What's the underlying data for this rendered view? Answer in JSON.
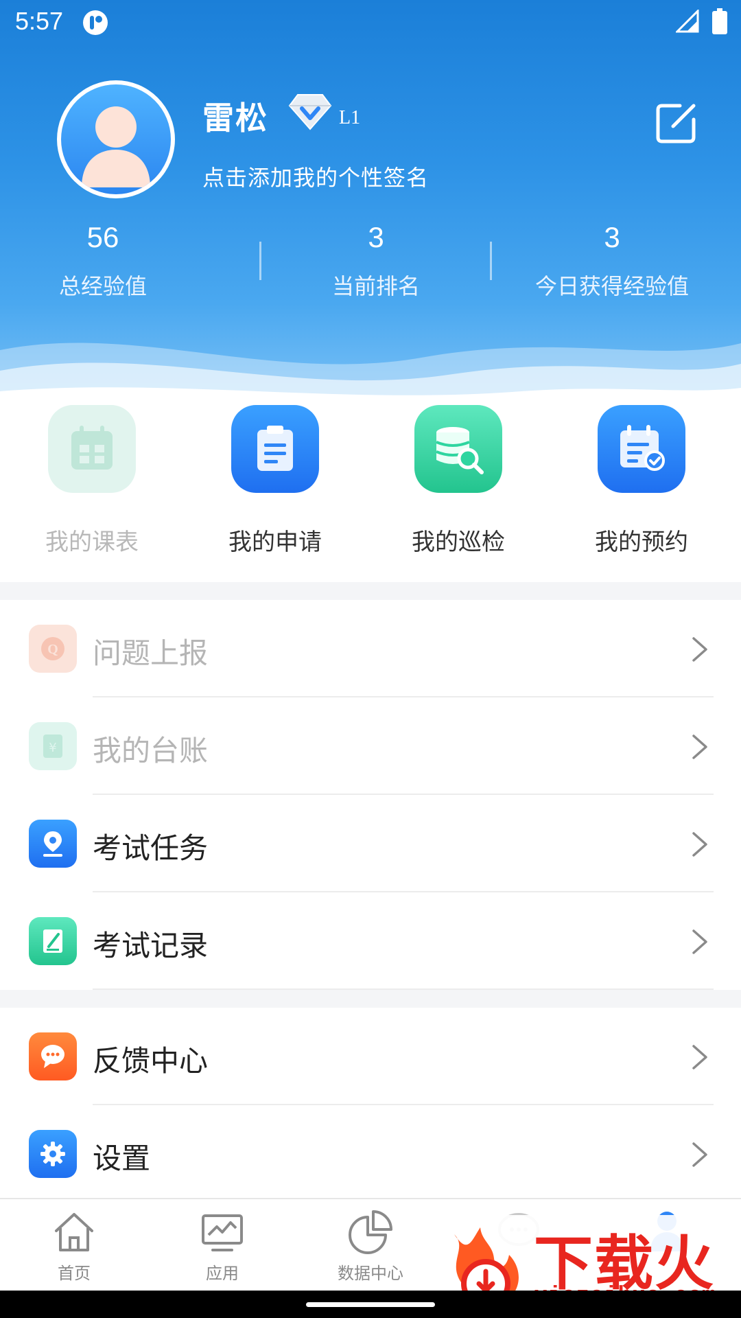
{
  "status_bar": {
    "time": "5:57"
  },
  "profile": {
    "name": "雷松",
    "level": "L1",
    "signature": "点击添加我的个性签名"
  },
  "stats": [
    {
      "value": "56",
      "label": "总经验值"
    },
    {
      "value": "3",
      "label": "当前排名"
    },
    {
      "value": "3",
      "label": "今日获得经验值"
    }
  ],
  "quick_actions": [
    {
      "label": "我的课表",
      "icon": "calendar-icon",
      "enabled": false
    },
    {
      "label": "我的申请",
      "icon": "clipboard-icon",
      "enabled": true
    },
    {
      "label": "我的巡检",
      "icon": "database-search-icon",
      "enabled": true
    },
    {
      "label": "我的预约",
      "icon": "calendar-check-icon",
      "enabled": true
    }
  ],
  "menu": [
    {
      "label": "问题上报",
      "icon": "question-report-icon",
      "enabled": false
    },
    {
      "label": "我的台账",
      "icon": "ledger-icon",
      "enabled": false
    },
    {
      "label": "考试任务",
      "icon": "pin-icon",
      "enabled": true
    },
    {
      "label": "考试记录",
      "icon": "note-pen-icon",
      "enabled": true
    },
    {
      "label": "反馈中心",
      "icon": "chat-icon",
      "enabled": true
    },
    {
      "label": "设置",
      "icon": "gear-icon",
      "enabled": true
    }
  ],
  "tabs": [
    {
      "label": "首页",
      "icon": "home-icon"
    },
    {
      "label": "应用",
      "icon": "monitor-chart-icon"
    },
    {
      "label": "数据中心",
      "icon": "pie-chart-icon"
    },
    {
      "label": "",
      "icon": "message-icon"
    },
    {
      "label": "",
      "icon": "profile-icon"
    }
  ],
  "watermark": {
    "title": "下载火",
    "url": "xiazaihuo.com"
  },
  "colors": {
    "header_blue": "#1b7fd8",
    "accent_blue": "#2f86f6",
    "accent_green": "#2fd5a0",
    "accent_orange": "#ff6a2b",
    "watermark_red": "#e8261f"
  }
}
